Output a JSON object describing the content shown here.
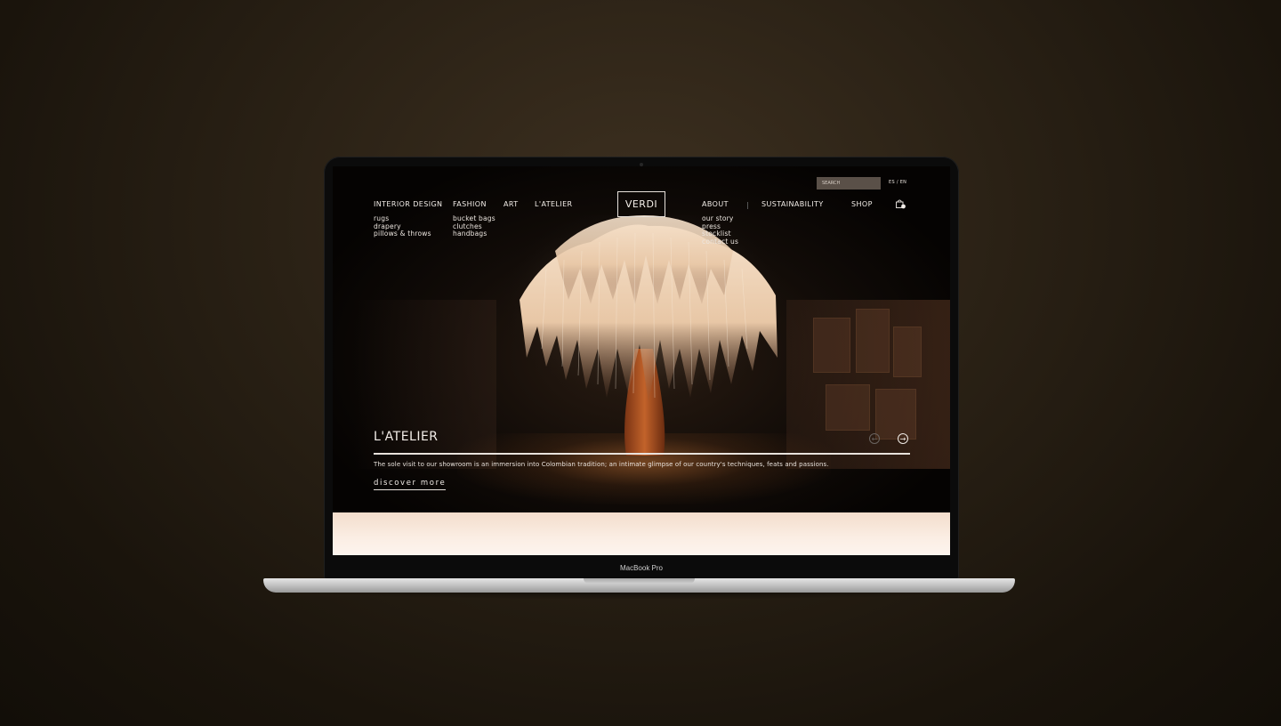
{
  "device": {
    "model_label": "MacBook Pro"
  },
  "site": {
    "search_placeholder": "SEARCH",
    "language_switch": "ES / EN",
    "logo_text": "VERDI",
    "nav": {
      "interior_design": {
        "label": "INTERIOR DESIGN",
        "sub": [
          "rugs",
          "drapery",
          "pillows & throws"
        ]
      },
      "fashion": {
        "label": "FASHION",
        "sub": [
          "bucket bags",
          "clutches",
          "handbags"
        ]
      },
      "art": {
        "label": "ART"
      },
      "atelier": {
        "label": "L'ATELIER"
      },
      "about": {
        "label": "ABOUT",
        "sub": [
          "our story",
          "press",
          "stocklist",
          "contact us"
        ]
      },
      "sustainability": {
        "label": "SUSTAINABILITY"
      },
      "shop": {
        "label": "SHOP"
      }
    },
    "hero": {
      "title": "L'ATELIER",
      "description": "The sole visit to our showroom is an immersion into Colombian tradition; an intimate glimpse of our country's techniques, feats and passions.",
      "cta": "discover more",
      "prev_arrow": "←",
      "next_arrow": "→"
    }
  },
  "colors": {
    "background": "#2a2115",
    "hero_text": "#f2ede8",
    "peach_band": "#fbeee4",
    "search_bg": "#5a5048"
  }
}
